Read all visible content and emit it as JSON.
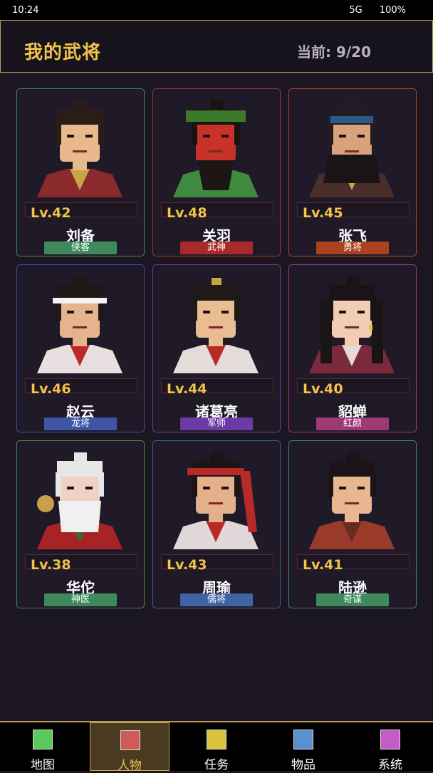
{
  "status_bar": {
    "time": "10:24",
    "network": "5G",
    "battery": "100%"
  },
  "header": {
    "title": "我的武将",
    "count": "当前: 9/20"
  },
  "generals": [
    {
      "level": "Lv.42",
      "name": "刘备",
      "tag": "侠客",
      "border_color": "#3f8a5c",
      "tag_color": "#3f8a5c",
      "icon": "liu-bei-portrait-icon"
    },
    {
      "level": "Lv.48",
      "name": "关羽",
      "tag": "武神",
      "border_color": "#a83232",
      "tag_color": "#a82a2a",
      "icon": "guan-yu-portrait-icon"
    },
    {
      "level": "Lv.45",
      "name": "张飞",
      "tag": "勇将",
      "border_color": "#b3472e",
      "tag_color": "#a8421f",
      "icon": "zhang-fei-portrait-icon"
    },
    {
      "level": "Lv.46",
      "name": "赵云",
      "tag": "龙将",
      "border_color": "#3e4f9a",
      "tag_color": "#3e55a4",
      "icon": "zhao-yun-portrait-icon"
    },
    {
      "level": "Lv.44",
      "name": "诸葛亮",
      "tag": "军师",
      "border_color": "#6b3f9a",
      "tag_color": "#6a3aa6",
      "icon": "zhuge-liang-portrait-icon"
    },
    {
      "level": "Lv.40",
      "name": "貂蝉",
      "tag": "红颜",
      "border_color": "#a03a7a",
      "tag_color": "#9c3a76",
      "icon": "diao-chan-portrait-icon"
    },
    {
      "level": "Lv.38",
      "name": "华佗",
      "tag": "神医",
      "border_color": "#3f8a5c",
      "tag_color": "#3f8a5c",
      "icon": "hua-tuo-portrait-icon"
    },
    {
      "level": "Lv.43",
      "name": "周瑜",
      "tag": "儒将",
      "border_color": "#3e5f9a",
      "tag_color": "#3e64a4",
      "icon": "zhou-yu-portrait-icon"
    },
    {
      "level": "Lv.41",
      "name": "陆逊",
      "tag": "奇谋",
      "border_color": "#3f8a5c",
      "tag_color": "#3f8a5c",
      "icon": "lu-xun-portrait-icon"
    }
  ],
  "nav": [
    {
      "label": "地图",
      "color": "#5ac95a",
      "active": false
    },
    {
      "label": "人物",
      "color": "#cf5a5a",
      "active": true
    },
    {
      "label": "任务",
      "color": "#d8c23a",
      "active": false
    },
    {
      "label": "物品",
      "color": "#5a8fd0",
      "active": false
    },
    {
      "label": "系统",
      "color": "#c65ac6",
      "active": false
    }
  ]
}
